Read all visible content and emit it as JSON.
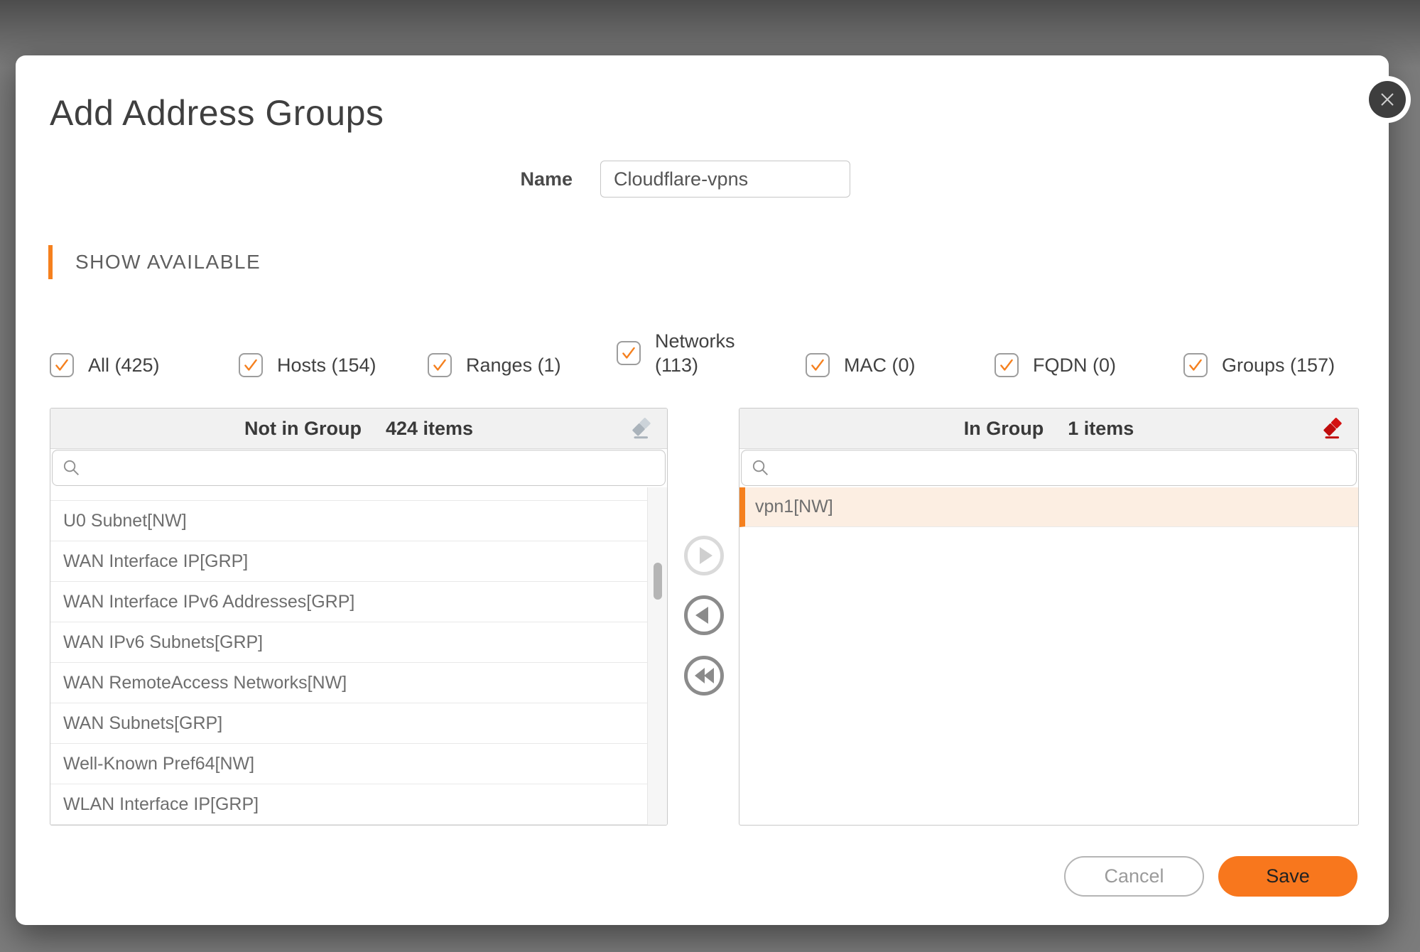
{
  "dialog": {
    "title": "Add Address Groups",
    "name_label": "Name",
    "name_value": "Cloudflare-vpns",
    "section_header": "SHOW AVAILABLE",
    "filters": [
      {
        "label": "All (425)",
        "checked": true
      },
      {
        "label": "Hosts (154)",
        "checked": true
      },
      {
        "label": "Ranges (1)",
        "checked": true
      },
      {
        "label": "Networks (113)",
        "checked": true
      },
      {
        "label": "MAC (0)",
        "checked": true
      },
      {
        "label": "FQDN (0)",
        "checked": true
      },
      {
        "label": "Groups (157)",
        "checked": true
      }
    ],
    "not_in_group": {
      "title": "Not in Group",
      "count_label": "424 items",
      "search_value": "",
      "items": [
        {
          "label": "U0 Subnet[NW]",
          "selected": false
        },
        {
          "label": "WAN Interface IP[GRP]",
          "selected": false
        },
        {
          "label": "WAN Interface IPv6 Addresses[GRP]",
          "selected": false
        },
        {
          "label": "WAN IPv6 Subnets[GRP]",
          "selected": false
        },
        {
          "label": "WAN RemoteAccess Networks[NW]",
          "selected": false
        },
        {
          "label": "WAN Subnets[GRP]",
          "selected": false
        },
        {
          "label": "Well-Known Pref64[NW]",
          "selected": false
        },
        {
          "label": "WLAN Interface IP[GRP]",
          "selected": false
        }
      ]
    },
    "in_group": {
      "title": "In Group",
      "count_label": "1 items",
      "search_value": "",
      "items": [
        {
          "label": "vpn1[NW]",
          "selected": true
        }
      ]
    },
    "footer": {
      "cancel": "Cancel",
      "save": "Save"
    },
    "colors": {
      "accent_orange": "#F5801E",
      "save_orange": "#F8771D",
      "selected_row_bg": "#FCEEE2",
      "eraser_red": "#CB0C0C",
      "eraser_gray": "#b7bec5",
      "backdrop": "#7c7c7c"
    }
  }
}
